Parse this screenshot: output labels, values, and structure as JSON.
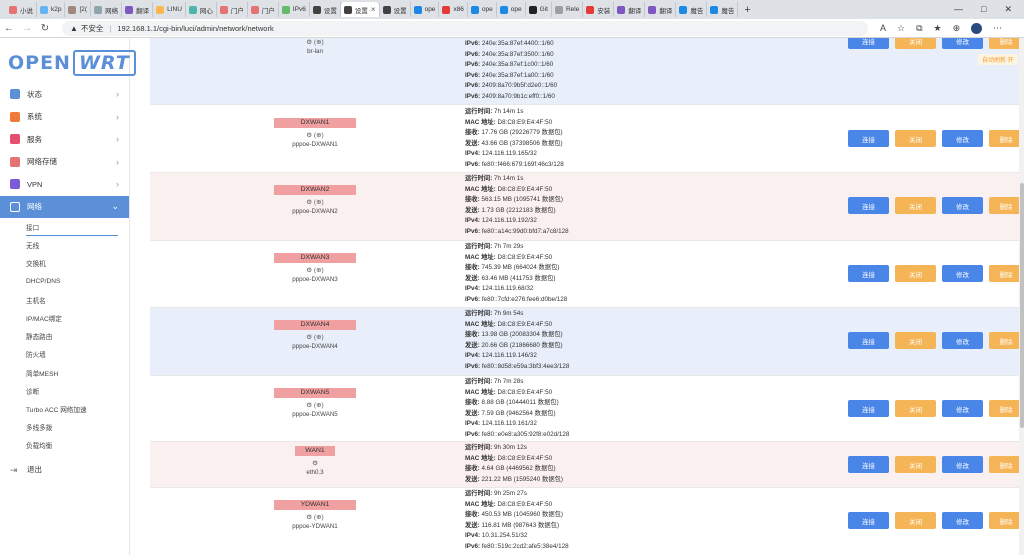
{
  "browser": {
    "tabs": [
      {
        "label": "小说",
        "color": "#e57373"
      },
      {
        "label": "k2p",
        "color": "#64b5f6"
      },
      {
        "label": "[2(",
        "color": "#a1887f"
      },
      {
        "label": "网络",
        "color": "#90a4ae"
      },
      {
        "label": "翻译",
        "color": "#7e57c2"
      },
      {
        "label": "LINU",
        "color": "#ffb74d"
      },
      {
        "label": "网心",
        "color": "#4db6ac"
      },
      {
        "label": "门户",
        "color": "#e57373"
      },
      {
        "label": "门户",
        "color": "#e57373"
      },
      {
        "label": "IPv6",
        "color": "#66bb6a"
      },
      {
        "label": "设置",
        "color": "#424242"
      },
      {
        "label": "设置",
        "color": "#424242"
      },
      {
        "label": "设置",
        "color": "#424242"
      },
      {
        "label": "ope",
        "color": "#1e88e5"
      },
      {
        "label": "x86",
        "color": "#e53935"
      },
      {
        "label": "ope",
        "color": "#1e88e5"
      },
      {
        "label": "ope",
        "color": "#1e88e5"
      },
      {
        "label": "Git",
        "color": "#212121"
      },
      {
        "label": "Rele",
        "color": "#9e9e9e"
      },
      {
        "label": "安装",
        "color": "#e53935"
      },
      {
        "label": "翻译",
        "color": "#7e57c2"
      },
      {
        "label": "翻译",
        "color": "#7e57c2"
      },
      {
        "label": "魔告",
        "color": "#1e88e5"
      },
      {
        "label": "魔告",
        "color": "#1e88e5"
      }
    ],
    "insecure_label": "不安全",
    "url": "192.168.1.1/cgi-bin/luci/admin/network/network"
  },
  "logo": {
    "left": "OPEN",
    "right": "WRT"
  },
  "menu": [
    {
      "label": "状态",
      "icon": "status-icon",
      "color": "#5b8fd8"
    },
    {
      "label": "系统",
      "icon": "gear-icon",
      "color": "#f07a3a"
    },
    {
      "label": "服务",
      "icon": "link-icon",
      "color": "#e4506e"
    },
    {
      "label": "网络存储",
      "icon": "storage-icon",
      "color": "#e57373"
    },
    {
      "label": "VPN",
      "icon": "vpn-icon",
      "color": "#7b5bd8"
    },
    {
      "label": "网络",
      "icon": "network-icon",
      "color": "#ffffff"
    }
  ],
  "submenu": [
    "接口",
    "无线",
    "交换机",
    "DHCP/DNS",
    "主机名",
    "IP/MAC绑定",
    "静态路由",
    "防火墙",
    "简单MESH",
    "诊断",
    "Turbo ACC 网络加速",
    "多线多拨",
    "负载均衡"
  ],
  "logout": "退出",
  "buttons": {
    "connect": "连接",
    "close": "关闭",
    "edit": "修改",
    "delete": "删除"
  },
  "autorefresh": "自动刷新 开",
  "labels": {
    "uptime": "运行时间:",
    "mac": "MAC 地址:",
    "rx": "接收:",
    "tx": "发送:",
    "ipv4": "IPv4:",
    "ipv6": "IPv6:"
  },
  "top_row": {
    "iface_name": "br-lan",
    "ipv6": [
      "240e:35a:87ef:4400::1/60",
      "240e:35a:87ef:3500::1/60",
      "240e:35a:87ef:1c00::1/60",
      "240e:35a:87ef:1a00::1/60",
      "2409:8a70:9b5f:d2e0::1/60",
      "2409:8a70:9b1c:eff0::1/60"
    ]
  },
  "interfaces": [
    {
      "badge": "DXWAN1",
      "name": "pppoe-DXWAN1",
      "uptime": "7h 14m 1s",
      "mac": "D8:C8:E9:E4:4F:50",
      "rx": "17.76 GB (29226779 数据包)",
      "tx": "43.66 GB (37398506 数据包)",
      "ipv4": "124.116.119.165/32",
      "ipv6": "fe80::f466:679:169f:46c3/128"
    },
    {
      "badge": "DXWAN2",
      "name": "pppoe-DXWAN2",
      "uptime": "7h 14m 1s",
      "mac": "D8:C8:E9:E4:4F:50",
      "rx": "563.15 MB (1095741 数据包)",
      "tx": "1.73 GB (2212183 数据包)",
      "ipv4": "124.116.119.192/32",
      "ipv6": "fe80::a14c:99d0:bfd7:a7c8/128"
    },
    {
      "badge": "DXWAN3",
      "name": "pppoe-DXWAN3",
      "uptime": "7h 7m 29s",
      "mac": "D8:C8:E9:E4:4F:50",
      "rx": "745.39 MB (664024 数据包)",
      "tx": "63.46 MB (411753 数据包)",
      "ipv4": "124.116.119.68/32",
      "ipv6": "fe80::7cfd:e276:fee6:d0be/128"
    },
    {
      "badge": "DXWAN4",
      "name": "pppoe-DXWAN4",
      "uptime": "7h 9m 54s",
      "mac": "D8:C8:E9:E4:4F:50",
      "rx": "13.98 GB (20083304 数据包)",
      "tx": "20.66 GB (21866680 数据包)",
      "ipv4": "124.116.119.146/32",
      "ipv6": "fe80::8d58:e59a:3bf3:4ee3/128"
    },
    {
      "badge": "DXWAN5",
      "name": "pppoe-DXWAN5",
      "uptime": "7h 7m 28s",
      "mac": "D8:C8:E9:E4:4F:50",
      "rx": "8.88 GB (10444011 数据包)",
      "tx": "7.59 GB (9462564 数据包)",
      "ipv4": "124.116.119.161/32",
      "ipv6": "fe80::e0e8:a305:92f8:e02d/128"
    },
    {
      "badge": "WAN1",
      "name": "eth0.3",
      "uptime": "9h 30m 12s",
      "mac": "D8:C8:E9:E4:4F:50",
      "rx": "4.64 GB (4469562 数据包)",
      "tx": "221.22 MB (1595240 数据包)",
      "ipv4": "",
      "ipv6": ""
    },
    {
      "badge": "YDWAN1",
      "name": "pppoe-YDWAN1",
      "uptime": "9h 25m 27s",
      "mac": "D8:C8:E9:E4:4F:50",
      "rx": "450.53 MB (1045960 数据包)",
      "tx": "116.81 MB (987643 数据包)",
      "ipv4": "10.31.254.51/32",
      "ipv6": "fe80::519c:2cd2:afe5:38e4/128"
    }
  ]
}
